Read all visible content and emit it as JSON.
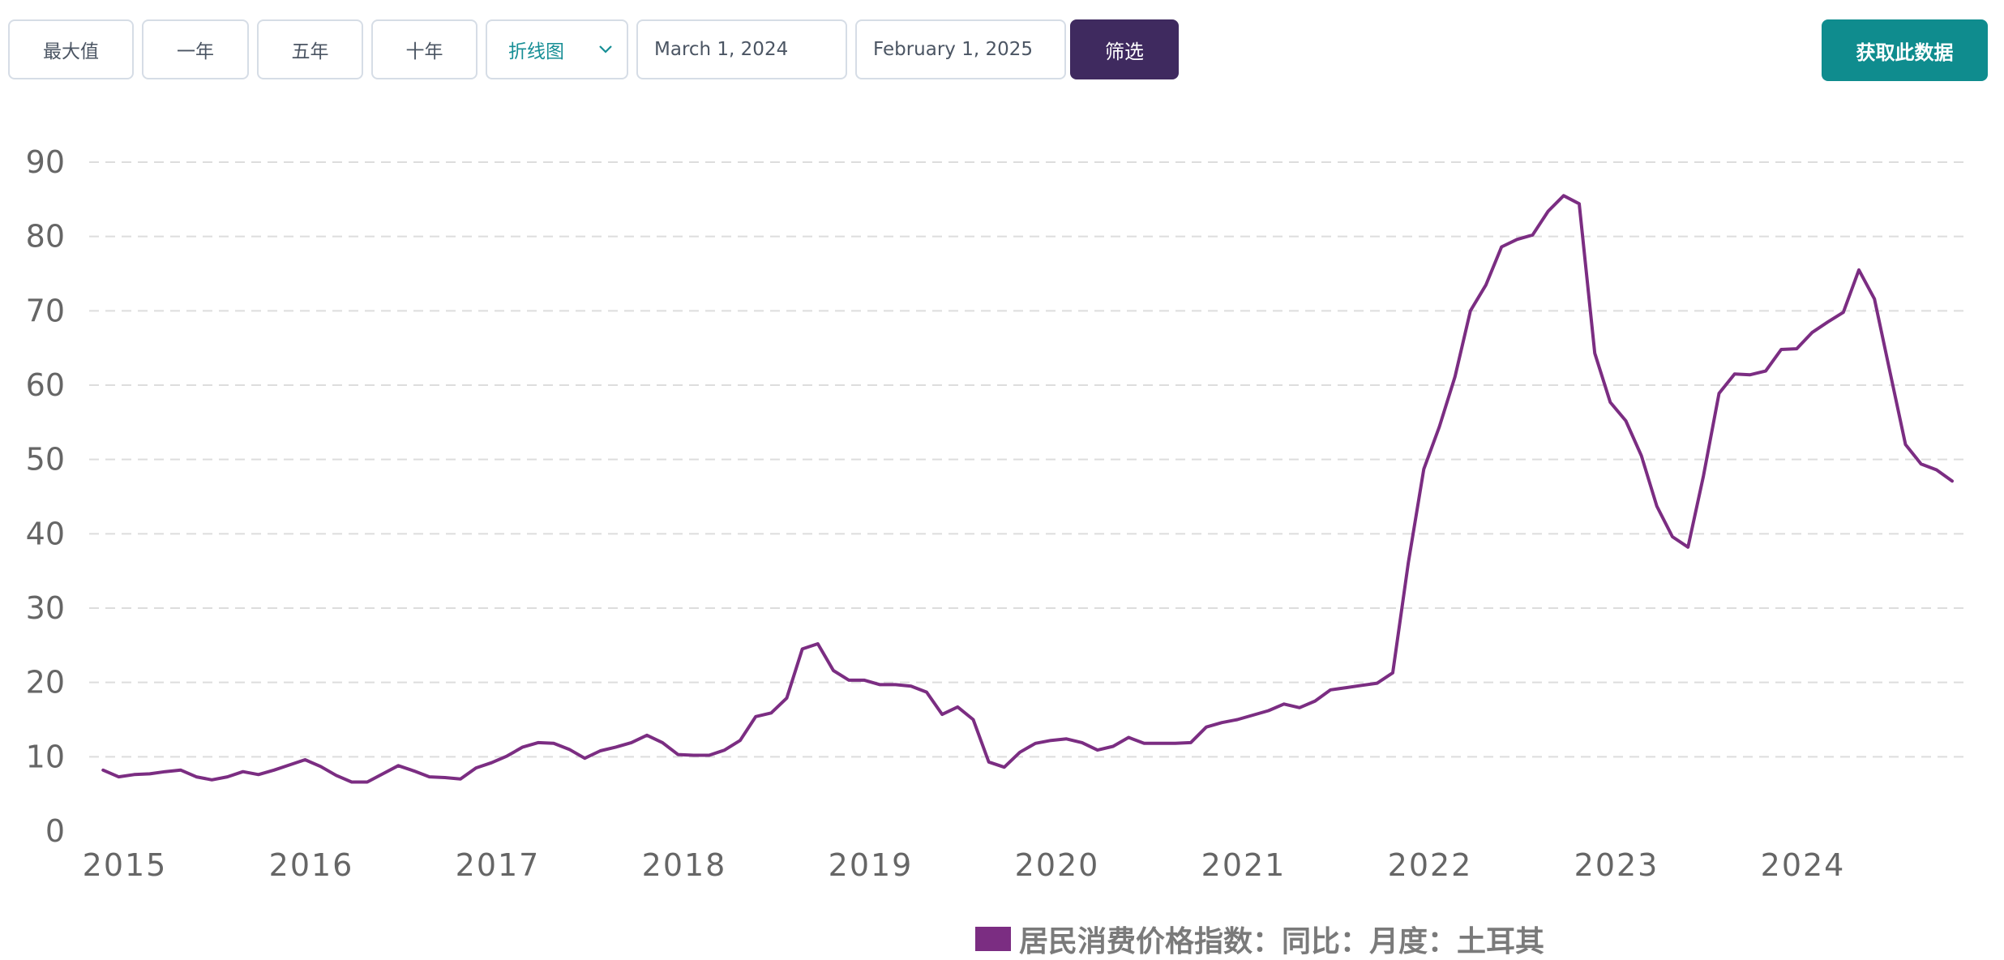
{
  "toolbar": {
    "range_buttons": [
      "最大值",
      "一年",
      "五年",
      "十年"
    ],
    "chart_type": "折线图",
    "start_date": "March 1, 2024",
    "end_date": "February 1, 2025",
    "filter_label": "筛选",
    "get_data_label": "获取此数据"
  },
  "colors": {
    "line": "#7b2d82",
    "filter_button": "#3f2a5f",
    "get_data_button": "#0f8c8e",
    "select_text": "#168e95",
    "grid": "#dddddd"
  },
  "chart_data": {
    "type": "line",
    "title": "",
    "xlabel": "",
    "ylabel": "",
    "ylim": [
      0,
      90
    ],
    "yticks": [
      0,
      10,
      20,
      30,
      40,
      50,
      60,
      70,
      80,
      90
    ],
    "xticks": [
      "2015",
      "2016",
      "2017",
      "2018",
      "2019",
      "2020",
      "2021",
      "2022",
      "2023",
      "2024"
    ],
    "xlim": [
      "2015-01",
      "2025-01"
    ],
    "grid": "horizontal dashed",
    "legend_position": "bottom-center",
    "series": [
      {
        "name": "居民消费价格指数：同比：月度：土耳其",
        "color": "#7b2d82",
        "points": [
          [
            "2015-02",
            8.2
          ],
          [
            "2015-03",
            7.3
          ],
          [
            "2015-04",
            7.6
          ],
          [
            "2015-05",
            7.7
          ],
          [
            "2015-06",
            8.0
          ],
          [
            "2015-07",
            8.2
          ],
          [
            "2015-08",
            7.3
          ],
          [
            "2015-09",
            6.9
          ],
          [
            "2015-10",
            7.3
          ],
          [
            "2015-11",
            8.0
          ],
          [
            "2015-12",
            7.6
          ],
          [
            "2016-01",
            8.2
          ],
          [
            "2016-02",
            8.9
          ],
          [
            "2016-03",
            9.6
          ],
          [
            "2016-04",
            8.7
          ],
          [
            "2016-05",
            7.5
          ],
          [
            "2016-06",
            6.6
          ],
          [
            "2016-07",
            6.6
          ],
          [
            "2016-08",
            7.7
          ],
          [
            "2016-09",
            8.8
          ],
          [
            "2016-10",
            8.1
          ],
          [
            "2016-11",
            7.3
          ],
          [
            "2016-12",
            7.2
          ],
          [
            "2017-01",
            7.0
          ],
          [
            "2017-02",
            8.5
          ],
          [
            "2017-03",
            9.2
          ],
          [
            "2017-04",
            10.1
          ],
          [
            "2017-05",
            11.3
          ],
          [
            "2017-06",
            11.9
          ],
          [
            "2017-07",
            11.8
          ],
          [
            "2017-08",
            11.0
          ],
          [
            "2017-09",
            9.8
          ],
          [
            "2017-10",
            10.8
          ],
          [
            "2017-11",
            11.3
          ],
          [
            "2017-12",
            11.9
          ],
          [
            "2018-01",
            12.9
          ],
          [
            "2018-02",
            11.9
          ],
          [
            "2018-03",
            10.3
          ],
          [
            "2018-04",
            10.2
          ],
          [
            "2018-05",
            10.2
          ],
          [
            "2018-06",
            10.9
          ],
          [
            "2018-07",
            12.2
          ],
          [
            "2018-08",
            15.4
          ],
          [
            "2018-09",
            15.9
          ],
          [
            "2018-10",
            17.9
          ],
          [
            "2018-11",
            24.5
          ],
          [
            "2018-12",
            25.2
          ],
          [
            "2019-01",
            21.6
          ],
          [
            "2019-02",
            20.3
          ],
          [
            "2019-03",
            20.3
          ],
          [
            "2019-04",
            19.7
          ],
          [
            "2019-05",
            19.7
          ],
          [
            "2019-06",
            19.5
          ],
          [
            "2019-07",
            18.7
          ],
          [
            "2019-08",
            15.7
          ],
          [
            "2019-09",
            16.7
          ],
          [
            "2019-10",
            15.0
          ],
          [
            "2019-11",
            9.3
          ],
          [
            "2019-12",
            8.6
          ],
          [
            "2020-01",
            10.6
          ],
          [
            "2020-02",
            11.8
          ],
          [
            "2020-03",
            12.2
          ],
          [
            "2020-04",
            12.4
          ],
          [
            "2020-05",
            11.9
          ],
          [
            "2020-06",
            10.9
          ],
          [
            "2020-07",
            11.4
          ],
          [
            "2020-08",
            12.6
          ],
          [
            "2020-09",
            11.8
          ],
          [
            "2020-10",
            11.8
          ],
          [
            "2020-11",
            11.8
          ],
          [
            "2020-12",
            11.9
          ],
          [
            "2021-01",
            14.0
          ],
          [
            "2021-02",
            14.6
          ],
          [
            "2021-03",
            15.0
          ],
          [
            "2021-04",
            15.6
          ],
          [
            "2021-05",
            16.2
          ],
          [
            "2021-06",
            17.1
          ],
          [
            "2021-07",
            16.6
          ],
          [
            "2021-08",
            17.5
          ],
          [
            "2021-09",
            19.0
          ],
          [
            "2021-10",
            19.3
          ],
          [
            "2021-11",
            19.6
          ],
          [
            "2021-12",
            19.9
          ],
          [
            "2022-01",
            21.3
          ],
          [
            "2022-02",
            36.1
          ],
          [
            "2022-03",
            48.7
          ],
          [
            "2022-04",
            54.4
          ],
          [
            "2022-05",
            61.1
          ],
          [
            "2022-06",
            70.0
          ],
          [
            "2022-07",
            73.5
          ],
          [
            "2022-08",
            78.6
          ],
          [
            "2022-09",
            79.6
          ],
          [
            "2022-10",
            80.2
          ],
          [
            "2022-11",
            83.4
          ],
          [
            "2022-12",
            85.5
          ],
          [
            "2023-01",
            84.4
          ],
          [
            "2023-02",
            64.3
          ],
          [
            "2023-03",
            57.7
          ],
          [
            "2023-04",
            55.2
          ],
          [
            "2023-05",
            50.5
          ],
          [
            "2023-06",
            43.7
          ],
          [
            "2023-07",
            39.6
          ],
          [
            "2023-08",
            38.2
          ],
          [
            "2023-09",
            47.8
          ],
          [
            "2023-10",
            58.9
          ],
          [
            "2023-11",
            61.5
          ],
          [
            "2023-12",
            61.4
          ],
          [
            "2024-01",
            61.9
          ],
          [
            "2024-02",
            64.8
          ],
          [
            "2024-03",
            64.9
          ],
          [
            "2024-04",
            67.1
          ],
          [
            "2024-05",
            68.5
          ],
          [
            "2024-06",
            69.8
          ],
          [
            "2024-07",
            75.5
          ],
          [
            "2024-08",
            71.6
          ],
          [
            "2024-09",
            61.8
          ],
          [
            "2024-10",
            52.0
          ],
          [
            "2024-11",
            49.4
          ],
          [
            "2024-12",
            48.6
          ],
          [
            "2025-01",
            47.1
          ]
        ]
      }
    ]
  }
}
